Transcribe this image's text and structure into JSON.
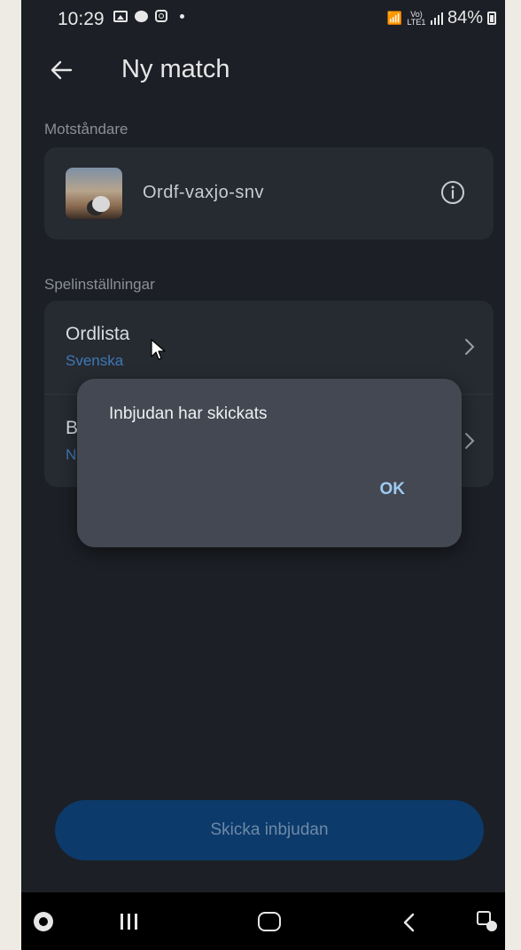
{
  "status": {
    "time": "10:29",
    "battery": "84%",
    "network": "Vo) LTE1"
  },
  "appbar": {
    "title": "Ny match"
  },
  "opponent": {
    "section_label": "Motståndare",
    "name": "Ordf-vaxjo-snv"
  },
  "settings": {
    "section_label": "Spelinställningar",
    "rows": [
      {
        "title": "Ordlista",
        "subtitle": "Svenska"
      },
      {
        "title": "B",
        "subtitle": "N"
      }
    ]
  },
  "dialog": {
    "message": "Inbjudan har skickats",
    "ok_label": "OK"
  },
  "send_button": {
    "label": "Skicka inbjudan"
  },
  "colors": {
    "background": "#1c1f25",
    "card": "#262a31",
    "dialog": "#444852",
    "accent": "#3e79b5",
    "button": "#0c3a6a"
  },
  "icons": [
    "back-arrow-icon",
    "info-icon",
    "chevron-right-icon",
    "gallery-icon",
    "chat-icon",
    "instagram-icon",
    "wifi-icon",
    "signal-icon",
    "battery-icon",
    "mouse-cursor-icon",
    "game-launcher-icon",
    "recent-apps-icon",
    "home-icon",
    "nav-back-icon",
    "assistant-icon"
  ]
}
